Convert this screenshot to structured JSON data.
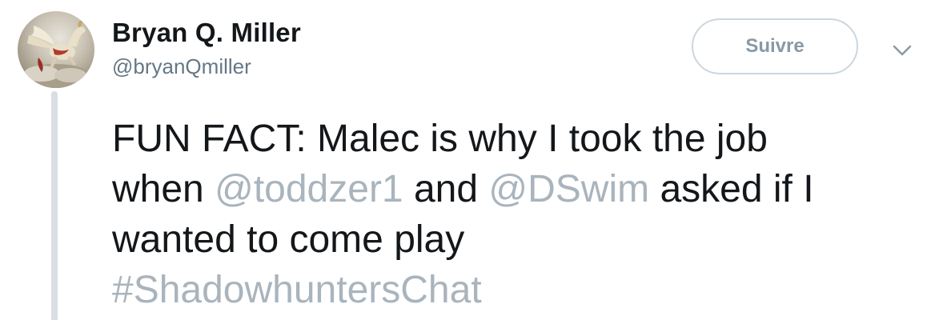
{
  "author": {
    "name": "Bryan Q. Miller",
    "handle": "@bryanQmiller",
    "avatar_icon": "pegasus-avatar"
  },
  "actions": {
    "follow_label": "Suivre",
    "menu_icon": "chevron-down-icon"
  },
  "tweet": {
    "line1": "FUN FACT: Malec is why I took the job",
    "line2_pre": "when ",
    "mention1": "@toddzer1",
    "line2_mid": " and ",
    "mention2": "@DSwim",
    "line2_post": " asked if I",
    "line3": "wanted to come play",
    "hashtag": "#ShadowhuntersChat"
  },
  "colors": {
    "text": "#14171a",
    "secondary": "#657786",
    "link_faded": "#a9b4bd",
    "border": "#ccd6dd",
    "thread_line": "#d8dee3"
  }
}
